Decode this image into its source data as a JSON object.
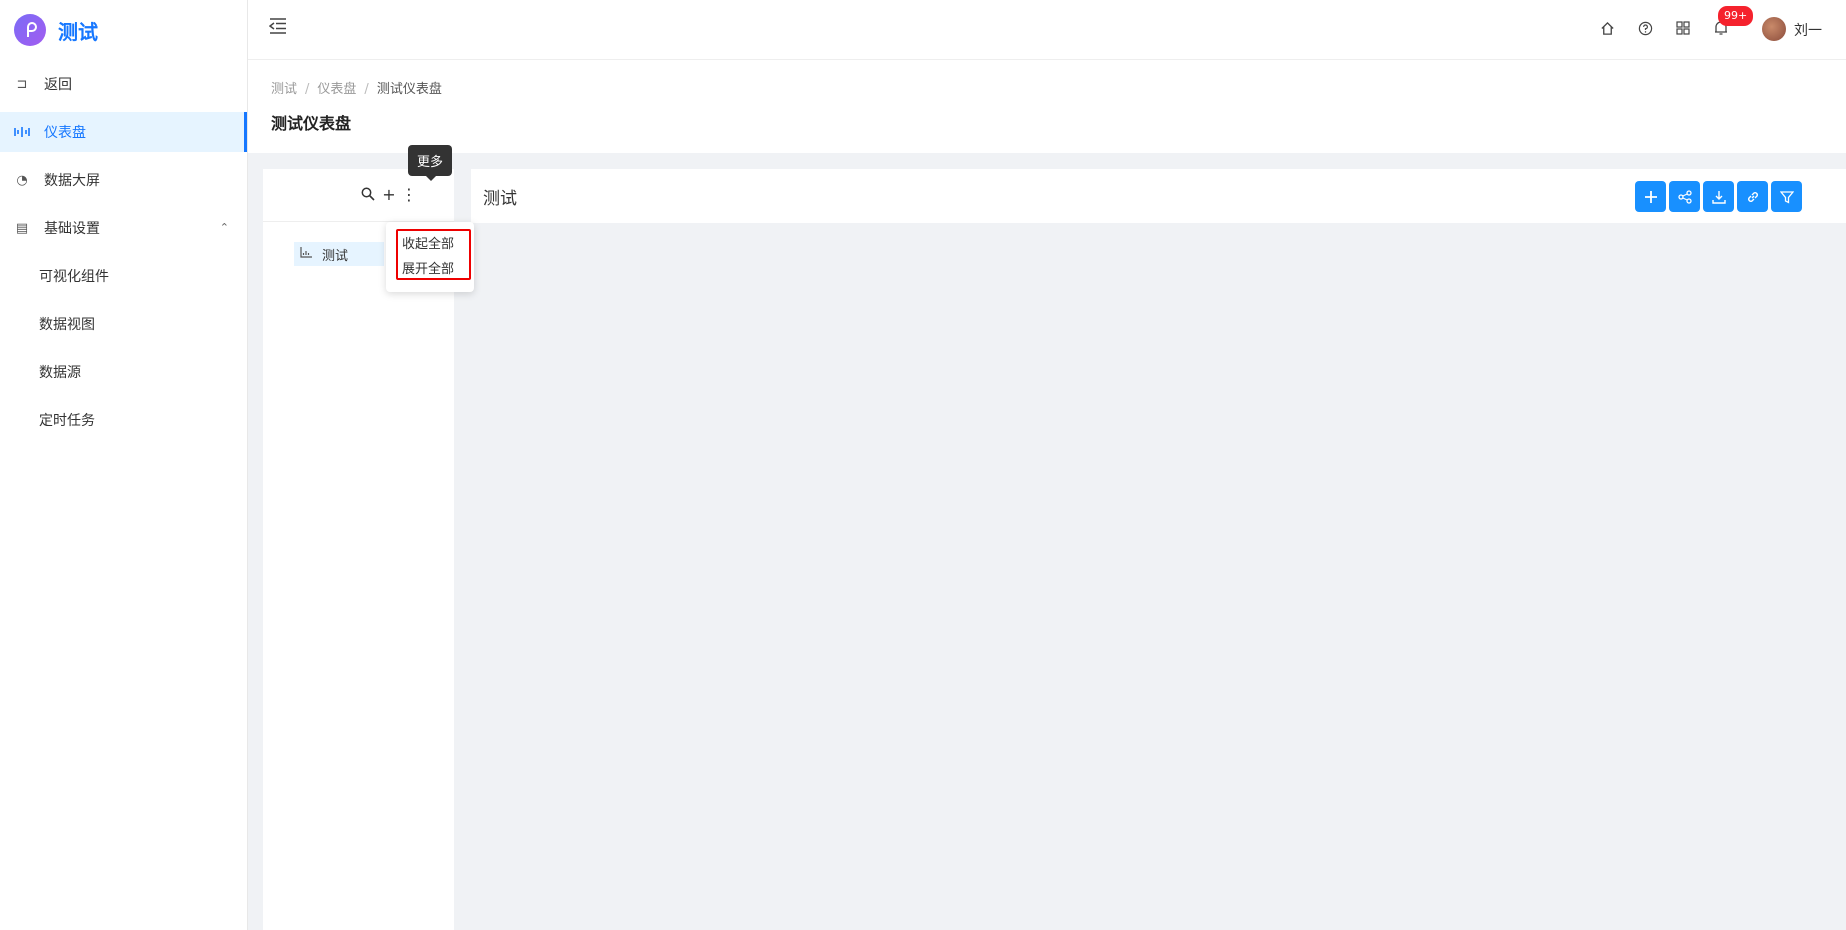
{
  "app": {
    "logo_glyph": "𝓹",
    "name": "测试",
    "accent": "#1677ff",
    "logo_gradient": [
      "#7b6cf6",
      "#a25cf0"
    ]
  },
  "sidebar": {
    "items": [
      {
        "label": "返回",
        "icon": "return-icon",
        "glyph": "⊐"
      },
      {
        "label": "仪表盘",
        "icon": "dashboard-icon",
        "glyph": "⟨⫴⟩",
        "active": true
      },
      {
        "label": "数据大屏",
        "icon": "pie-chart-icon",
        "glyph": "◔"
      },
      {
        "label": "基础设置",
        "icon": "settings-book-icon",
        "glyph": "▤",
        "expanded": true,
        "caret": "⌃"
      }
    ],
    "sub_items": [
      {
        "label": "可视化组件"
      },
      {
        "label": "数据视图"
      },
      {
        "label": "数据源"
      },
      {
        "label": "定时任务"
      }
    ]
  },
  "header": {
    "icons": [
      "home-icon",
      "help-icon",
      "apps-grid-icon",
      "bell-icon"
    ],
    "notification_badge": "99+",
    "username": "刘一",
    "more_glyph": "⋮"
  },
  "breadcrumb": {
    "items": [
      "测试",
      "仪表盘",
      "测试仪表盘"
    ],
    "separator": "/"
  },
  "page_title": "测试仪表盘",
  "tree": {
    "toolbar": {
      "search_glyph": "🔍",
      "add_glyph": "+",
      "more_glyph": "⋮"
    },
    "nodes": [
      {
        "label": "测试",
        "icon": "chart-icon",
        "glyph": "⩇"
      }
    ]
  },
  "tooltip": {
    "text": "更多"
  },
  "dropdown": {
    "items": [
      "收起全部",
      "展开全部"
    ],
    "highlight_color": "#ee0000"
  },
  "dashboard": {
    "title": "测试",
    "actions": [
      {
        "name": "add",
        "icon": "plus-icon"
      },
      {
        "name": "share",
        "icon": "share-icon"
      },
      {
        "name": "download",
        "icon": "download-icon"
      },
      {
        "name": "link",
        "icon": "link-icon"
      },
      {
        "name": "filter",
        "icon": "filter-icon"
      }
    ],
    "action_color": "#1890ff"
  }
}
